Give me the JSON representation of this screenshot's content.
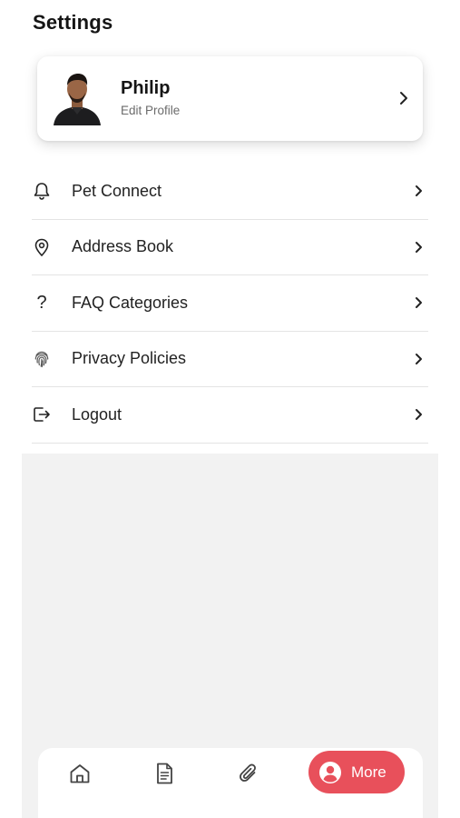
{
  "header": {
    "title": "Settings"
  },
  "profile": {
    "name": "Philip",
    "subtitle": "Edit Profile"
  },
  "menu": {
    "items": [
      {
        "label": "Pet Connect",
        "icon": "bell-icon"
      },
      {
        "label": "Address Book",
        "icon": "location-pin-icon"
      },
      {
        "label": "FAQ Categories",
        "icon": "question-icon"
      },
      {
        "label": "Privacy Policies",
        "icon": "fingerprint-icon"
      },
      {
        "label": "Logout",
        "icon": "logout-icon"
      }
    ]
  },
  "bottom_nav": {
    "items": [
      {
        "icon": "home-icon"
      },
      {
        "icon": "document-icon"
      },
      {
        "icon": "paperclip-icon"
      }
    ],
    "active": {
      "label": "More",
      "icon": "user-circle-icon"
    }
  },
  "colors": {
    "accent": "#e8505b",
    "background_grey": "#f2f2f2"
  }
}
